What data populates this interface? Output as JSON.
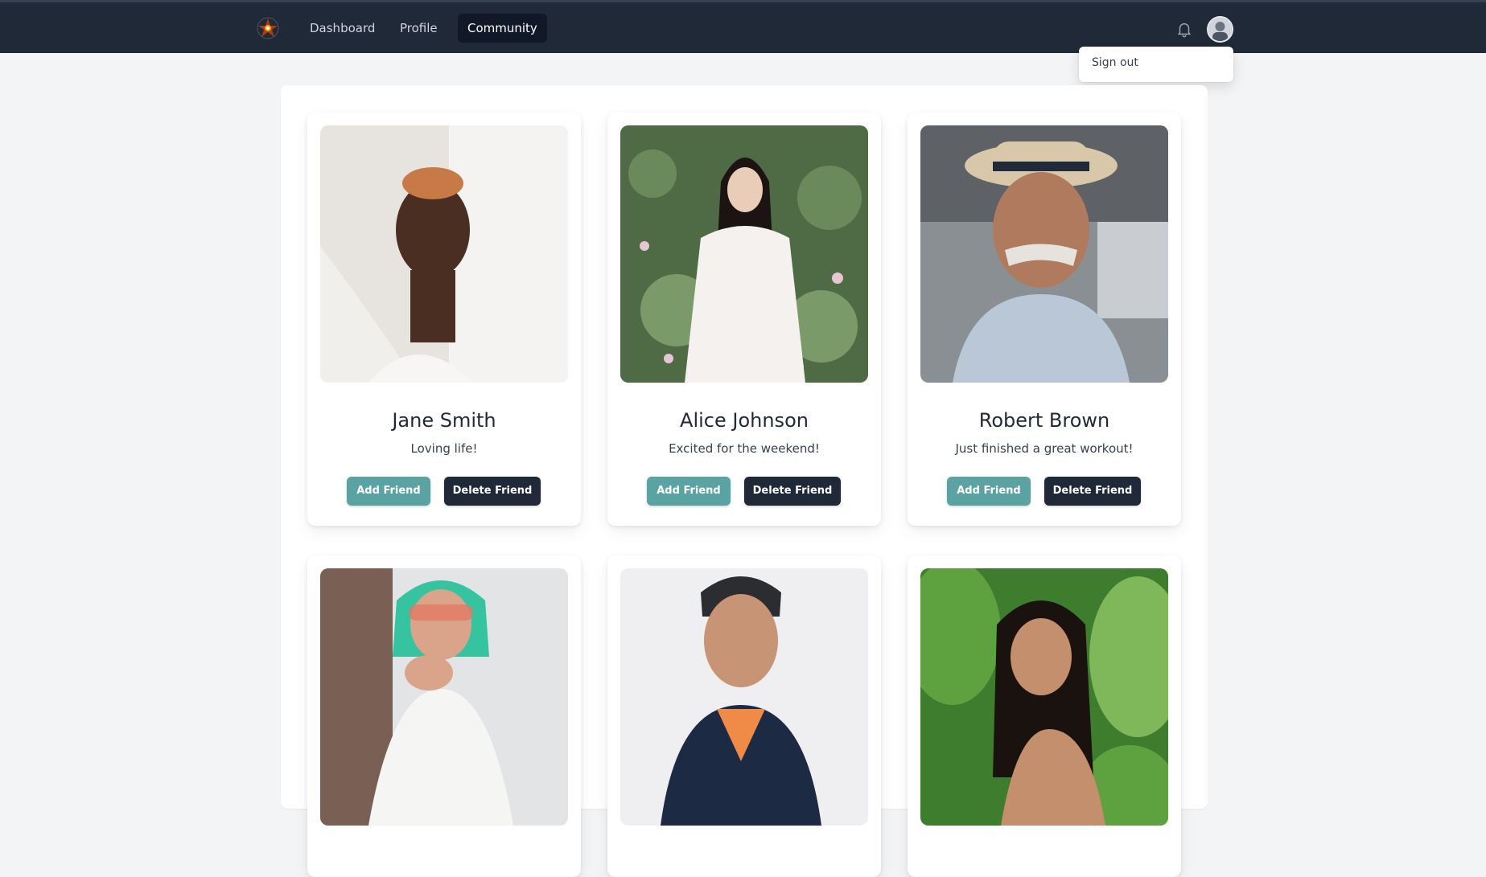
{
  "nav": {
    "links": [
      {
        "label": "Dashboard"
      },
      {
        "label": "Profile"
      },
      {
        "label": "Community"
      }
    ]
  },
  "user_menu": {
    "items": [
      {
        "label": "Sign out"
      }
    ]
  },
  "actions": {
    "add_label": "Add Friend",
    "delete_label": "Delete Friend"
  },
  "people": [
    {
      "name": "Jane Smith",
      "status": "Loving life!"
    },
    {
      "name": "Alice Johnson",
      "status": "Excited for the weekend!"
    },
    {
      "name": "Robert Brown",
      "status": "Just finished a great workout!"
    },
    {
      "name": "",
      "status": ""
    },
    {
      "name": "",
      "status": ""
    },
    {
      "name": "",
      "status": ""
    }
  ],
  "colors": {
    "topbar": "#1f2937",
    "active_tab": "#111827",
    "add_button": "#5ba3a3",
    "delete_button": "#1f2937",
    "background": "#f3f4f6"
  },
  "icons": {
    "logo": "flower-logo-icon",
    "notifications": "bell-icon"
  }
}
